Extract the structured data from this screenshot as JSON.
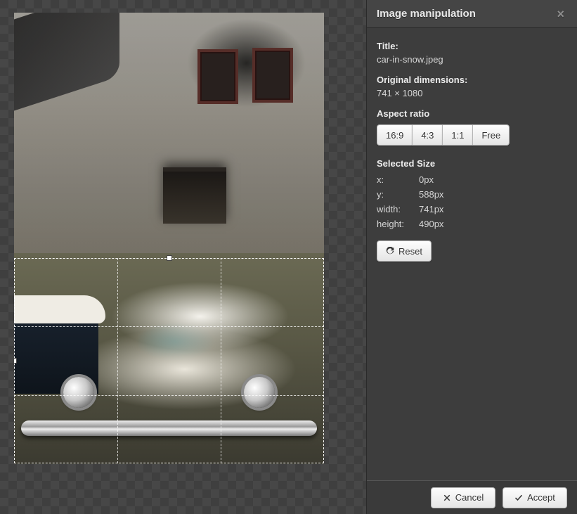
{
  "panel": {
    "title": "Image manipulation",
    "fields": {
      "title_label": "Title:",
      "title_value": "car-in-snow.jpeg",
      "orig_label": "Original dimensions:",
      "orig_value": "741 × 1080"
    },
    "aspect": {
      "label": "Aspect ratio",
      "options": [
        "16:9",
        "4:3",
        "1:1",
        "Free"
      ]
    },
    "selected": {
      "label": "Selected Size",
      "x_label": "x:",
      "x_value": "0px",
      "y_label": "y:",
      "y_value": "588px",
      "w_label": "width:",
      "w_value": "741px",
      "h_label": "height:",
      "h_value": "490px"
    },
    "reset_label": "Reset",
    "footer": {
      "cancel": "Cancel",
      "accept": "Accept"
    }
  }
}
